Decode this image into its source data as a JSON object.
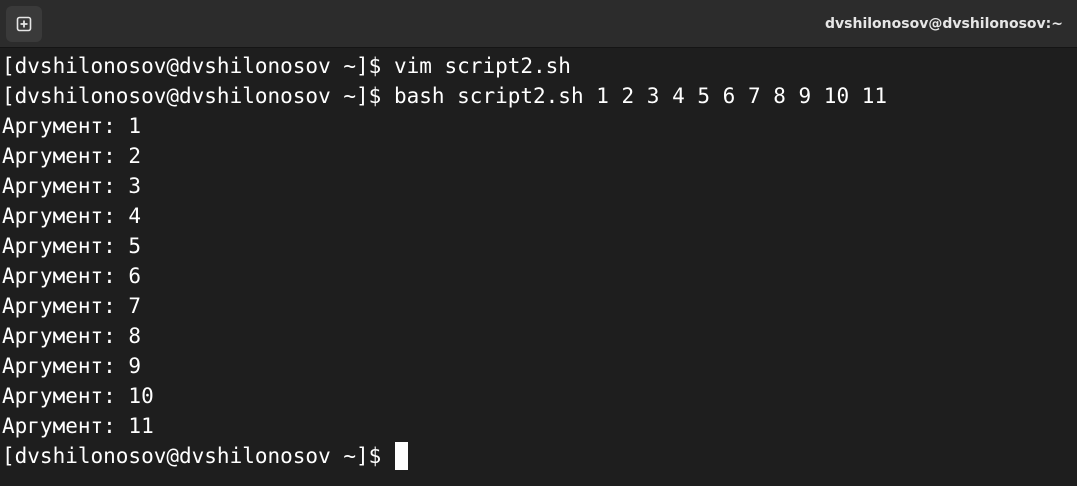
{
  "window": {
    "title": "dvshilonosov@dvshilonosov:~"
  },
  "icons": {
    "new_tab": "new-tab-plus-icon"
  },
  "colors": {
    "background": "#1e1e1e",
    "titlebar": "#2c2c2c",
    "text": "#ffffff"
  },
  "terminal": {
    "lines": [
      {
        "prompt": "[dvshilonosov@dvshilonosov ~]$ ",
        "command": "vim script2.sh"
      },
      {
        "prompt": "[dvshilonosov@dvshilonosov ~]$ ",
        "command": "bash script2.sh 1 2 3 4 5 6 7 8 9 10 11"
      },
      {
        "output": "Аргумент: 1"
      },
      {
        "output": "Аргумент: 2"
      },
      {
        "output": "Аргумент: 3"
      },
      {
        "output": "Аргумент: 4"
      },
      {
        "output": "Аргумент: 5"
      },
      {
        "output": "Аргумент: 6"
      },
      {
        "output": "Аргумент: 7"
      },
      {
        "output": "Аргумент: 8"
      },
      {
        "output": "Аргумент: 9"
      },
      {
        "output": "Аргумент: 10"
      },
      {
        "output": "Аргумент: 11"
      },
      {
        "prompt": "[dvshilonosov@dvshilonosov ~]$ ",
        "command": ""
      }
    ]
  }
}
